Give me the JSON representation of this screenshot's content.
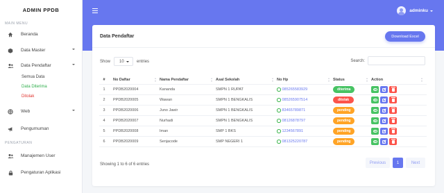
{
  "sidebar": {
    "brand": "ADMIN PPDB",
    "section_main": "MAIN MENU",
    "section_settings": "PENGATURAN",
    "items": {
      "beranda": "Beranda",
      "data_master": "Data Master",
      "data_pendaftar": "Data Pendaftar",
      "web": "Web",
      "pengumuman": "Pengumuman",
      "manajemen_user": "Manajemen User",
      "pengaturan_aplikasi": "Pengaturan Aplikasi"
    },
    "sub_items": {
      "semua_data": "Semua Data",
      "data_diterima": "Data Diterima",
      "ditolak": "Ditolak"
    }
  },
  "topbar": {
    "user_name": "adminku"
  },
  "main": {
    "card_title": "Data Pendaftar",
    "download_label": "Download Excel",
    "show_label": "Show",
    "show_value": "10",
    "entries_label": "entries",
    "search_label": "Search:",
    "search_value": "",
    "table": {
      "headers": {
        "no": "#",
        "no_daftar": "No Daftar",
        "nama": "Nama Pendaftar",
        "asal": "Asal Sekolah",
        "hp": "No Hp",
        "status": "Status",
        "action": "Action"
      },
      "rows": [
        {
          "no": "1",
          "no_daftar": "PPDB2020004",
          "nama": "Kananda",
          "asal": "SMPN 1 RUPAT",
          "hp": "085265583929",
          "status": "diterima",
          "status_color": "green"
        },
        {
          "no": "2",
          "no_daftar": "PPDB2020005",
          "nama": "Wawan",
          "asal": "SMPN 1 BENGKALIS",
          "hp": "085265907514",
          "status": "ditolak",
          "status_color": "red"
        },
        {
          "no": "3",
          "no_daftar": "PPDB2020006",
          "nama": "Juno Jawir",
          "asal": "SMPN 1 BENGKALIS",
          "hp": "83465789871",
          "status": "pending",
          "status_color": "yellow"
        },
        {
          "no": "4",
          "no_daftar": "PPDB2020007",
          "nama": "Nurhadi",
          "asal": "SMPN 1 BENGKALIS",
          "hp": "08126878797",
          "status": "pending",
          "status_color": "yellow"
        },
        {
          "no": "5",
          "no_daftar": "PPDB2020008",
          "nama": "Iman",
          "asal": "SMP 1 BKS",
          "hp": "1234567891",
          "status": "pending",
          "status_color": "yellow"
        },
        {
          "no": "6",
          "no_daftar": "PPDB2020009",
          "nama": "Senjacode",
          "asal": "SMP NEGERI 1",
          "hp": "081325220787",
          "status": "pending",
          "status_color": "yellow"
        }
      ]
    },
    "info_text": "Showing 1 to 6 of 6 entries",
    "pagination": {
      "previous": "Previous",
      "page": "1",
      "next": "Next"
    }
  },
  "colors": {
    "primary": "#6777ef",
    "success": "#47c363",
    "danger": "#fc544b",
    "warning": "#ffa426"
  }
}
